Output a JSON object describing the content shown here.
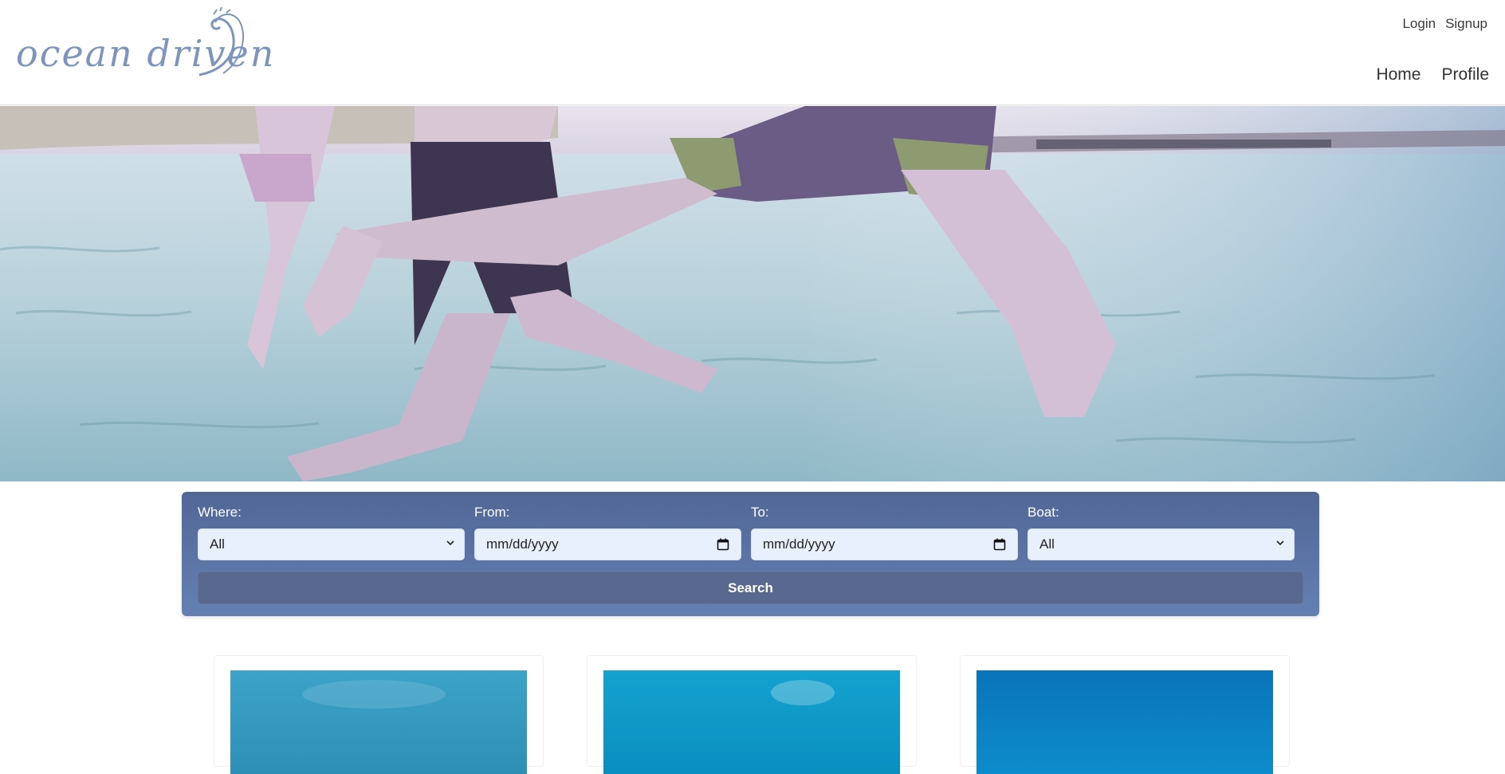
{
  "brand": {
    "logo_text": "ocean driven"
  },
  "header": {
    "top_links": [
      "Login",
      "Signup"
    ],
    "nav": [
      "Home",
      "Profile"
    ]
  },
  "search": {
    "where": {
      "label": "Where:",
      "value": "All"
    },
    "from": {
      "label": "From:",
      "value": "mm/dd/yyyy"
    },
    "to": {
      "label": "To:",
      "value": "mm/dd/yyyy"
    },
    "boat": {
      "label": "Boat:",
      "value": "All"
    },
    "button_label": "Search"
  },
  "colors": {
    "panel": "#516796",
    "button": "#59688f",
    "logo": "#7d95bd"
  }
}
